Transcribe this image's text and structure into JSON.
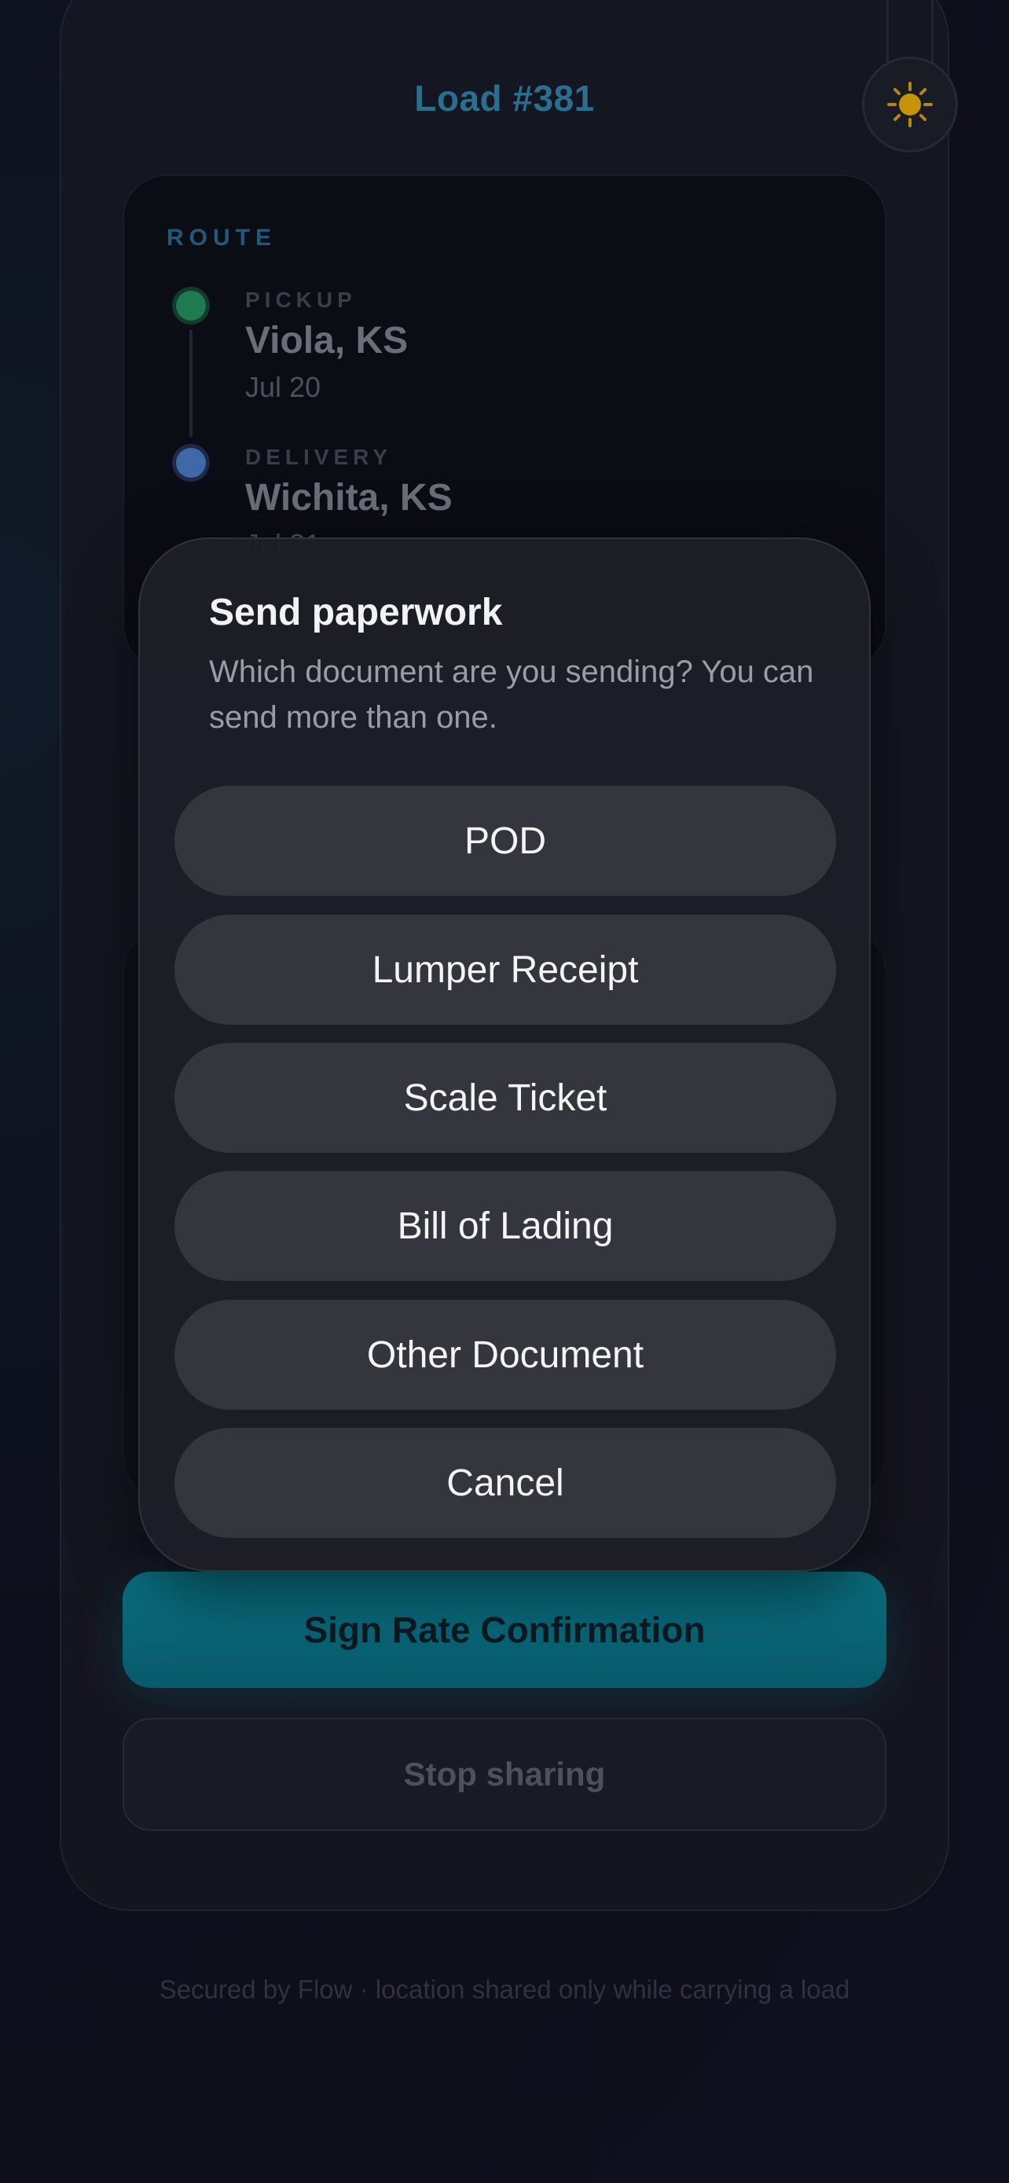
{
  "header": {
    "title": "Load #381"
  },
  "theme_toggle": {
    "icon": "sun-icon",
    "color": "#d49a0e"
  },
  "route": {
    "label": "ROUTE",
    "pickup": {
      "kind": "PICKUP",
      "city": "Viola, KS",
      "date": "Jul 20"
    },
    "delivery": {
      "kind": "DELIVERY",
      "city": "Wichita, KS",
      "date": "Jul 21"
    }
  },
  "actions": {
    "sign_label": "Sign Rate Confirmation",
    "stop_label": "Stop sharing"
  },
  "footer": {
    "note": "Secured by Flow · location shared only while carrying a load"
  },
  "sheet": {
    "title": "Send paperwork",
    "subtitle": "Which document are you sending? You can send more than one.",
    "options": [
      "POD",
      "Lumper Receipt",
      "Scale Ticket",
      "Bill of Lading",
      "Other Document"
    ],
    "cancel_label": "Cancel"
  },
  "colors": {
    "accent": "#2b6f8e",
    "primary_button": "#0a6f80",
    "pickup_dot": "#1f7a52",
    "delivery_dot": "#3f68a8"
  }
}
